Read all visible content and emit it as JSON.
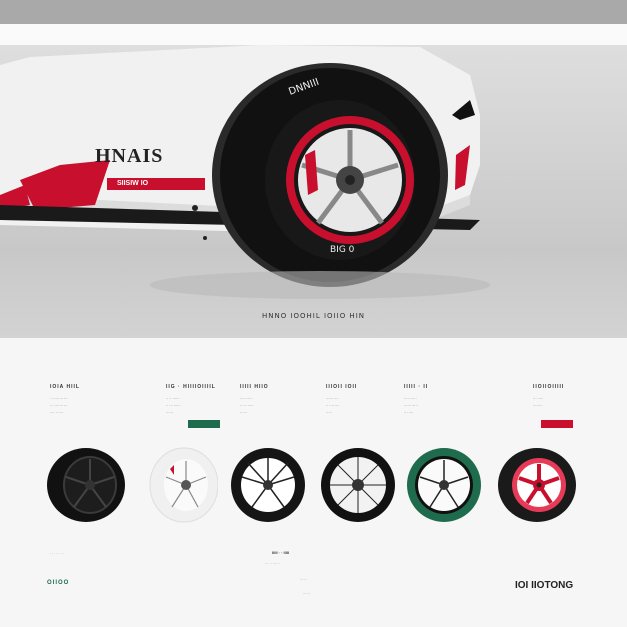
{
  "nav": {
    "items": [
      "······",
      "······",
      "·····",
      "······",
      "·····",
      "········"
    ],
    "menu_icon": "menu-icon"
  },
  "hero": {
    "car_badge": "HNAIS",
    "car_stripe": "SIISIW IO",
    "tire_sidewall": "BIG 0",
    "caption": "HNNO IOOHIL IOIIO HIN"
  },
  "products": [
    {
      "title": "IOIA HIIL",
      "desc": "· ······ ······\n·· ····· ······\n···· ·· ····",
      "cta_color": "",
      "rim": "#1d1d1d",
      "tire": "#111",
      "spoke": "#2a2a2a"
    },
    {
      "title": "IIG · HIIIIOIIIIL",
      "desc": "·· ·· ······\n·· ··· ······\n······",
      "cta_color": "#1f6b4d",
      "rim": "#ffffff",
      "tire": "#fafafa",
      "spoke": "#222"
    },
    {
      "title": "IIIII HIIO",
      "desc": "····· ·····\n·· ··· ·····\n······",
      "cta_color": "",
      "rim": "#ffffff",
      "tire": "#151515",
      "spoke": "#222"
    },
    {
      "title": "IIIOII IOII",
      "desc": "······ ····\n·· ···· ····\n·····",
      "cta_color": "",
      "rim": "#f2f2f2",
      "tire": "#111",
      "spoke": "#222"
    },
    {
      "title": "IIIII · II",
      "desc": "····· ·····\n······ ·····\n·· ·····",
      "cta_color": "",
      "rim": "#fafafa",
      "tire": "#1f6b4d",
      "spoke": "#222"
    },
    {
      "title": "IIOIIOIIIII",
      "desc": "··· ·····\n······· ·\n",
      "cta_color": "#c8102e",
      "rim": "#e63a56",
      "tire": "#1a1a1a",
      "spoke": "#c8102e"
    }
  ],
  "footer": {
    "left": "OIIOO",
    "right": "IOI IIOTONG",
    "center_top": "IIIII · · IIIII",
    "center_mid": "··· ·· ······",
    "center_bot": "······"
  }
}
